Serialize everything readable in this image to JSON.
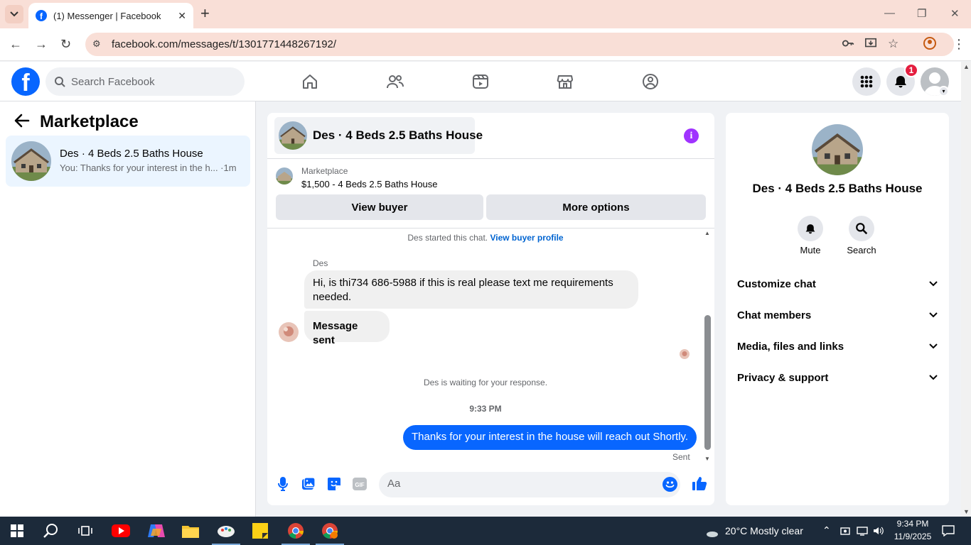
{
  "browser": {
    "tab_title": "(1) Messenger | Facebook",
    "url": "facebook.com/messages/t/1301771448267192/"
  },
  "facebook": {
    "search_placeholder": "Search Facebook",
    "notification_count": "1",
    "nav_icons": [
      "home-icon",
      "friends-icon",
      "video-icon",
      "marketplace-icon",
      "groups-icon"
    ]
  },
  "left_panel": {
    "title": "Marketplace",
    "conversations": [
      {
        "name": "Des · 4 Beds 2.5 Baths House",
        "snippet": "You: Thanks for your interest in the h... ·1m"
      }
    ]
  },
  "chat": {
    "header_name": "Des · 4 Beds 2.5 Baths House",
    "marketplace_label": "Marketplace",
    "listing": "$1,500 - 4 Beds 2.5 Baths House",
    "view_buyer": "View buyer",
    "more_options": "More options",
    "started_text": "Des started this chat.",
    "started_link": "View buyer profile",
    "sender_name": "Des",
    "messages_in": [
      "Hi, is thi734 686-5988 if this is real please text me requirements needed.",
      "Message sent"
    ],
    "waiting_text": "Des is waiting for your response.",
    "timestamp": "9:33 PM",
    "message_out": "Thanks for your interest in the house will reach out Shortly.",
    "sent_label": "Sent",
    "composer_placeholder": "Aa",
    "accent_color": "#0866ff"
  },
  "right_panel": {
    "name": "Des · 4 Beds 2.5 Baths House",
    "actions": [
      "Mute",
      "Search"
    ],
    "sections": [
      "Customize chat",
      "Chat members",
      "Media, files and links",
      "Privacy & support"
    ]
  },
  "taskbar": {
    "weather": "20°C  Mostly clear",
    "time": "9:34 PM",
    "date": "11/9/2025"
  }
}
